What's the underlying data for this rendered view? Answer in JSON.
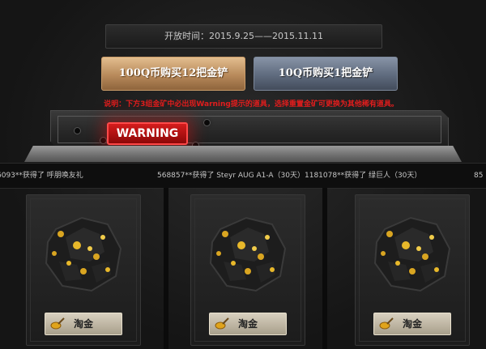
{
  "open_time": "开放时间：2015.9.25——2015.11.11",
  "buttons": {
    "buy_12": "100Q币购买12把金铲",
    "buy_1": "10Q币购买1把金铲"
  },
  "note": "说明：下方3组金矿中必出现Warning提示的道具，选择重置金矿可更换为其他稀有道具。",
  "warning_label": "WARNING",
  "ticker": [
    "6093**获得了 呼朋唤友礼",
    "568857**获得了 Steyr AUG A1-A（30天）",
    "1181078**获得了 绿巨人（30天）",
    "85"
  ],
  "cards": [
    {
      "button": "淘金",
      "icon": "gold-shovel-icon"
    },
    {
      "button": "淘金",
      "icon": "gold-shovel-icon"
    },
    {
      "button": "淘金",
      "icon": "gold-shovel-icon"
    }
  ],
  "colors": {
    "note_red": "#e11d1d",
    "warning_red": "#d41c1c",
    "gold": "#d9a521"
  }
}
